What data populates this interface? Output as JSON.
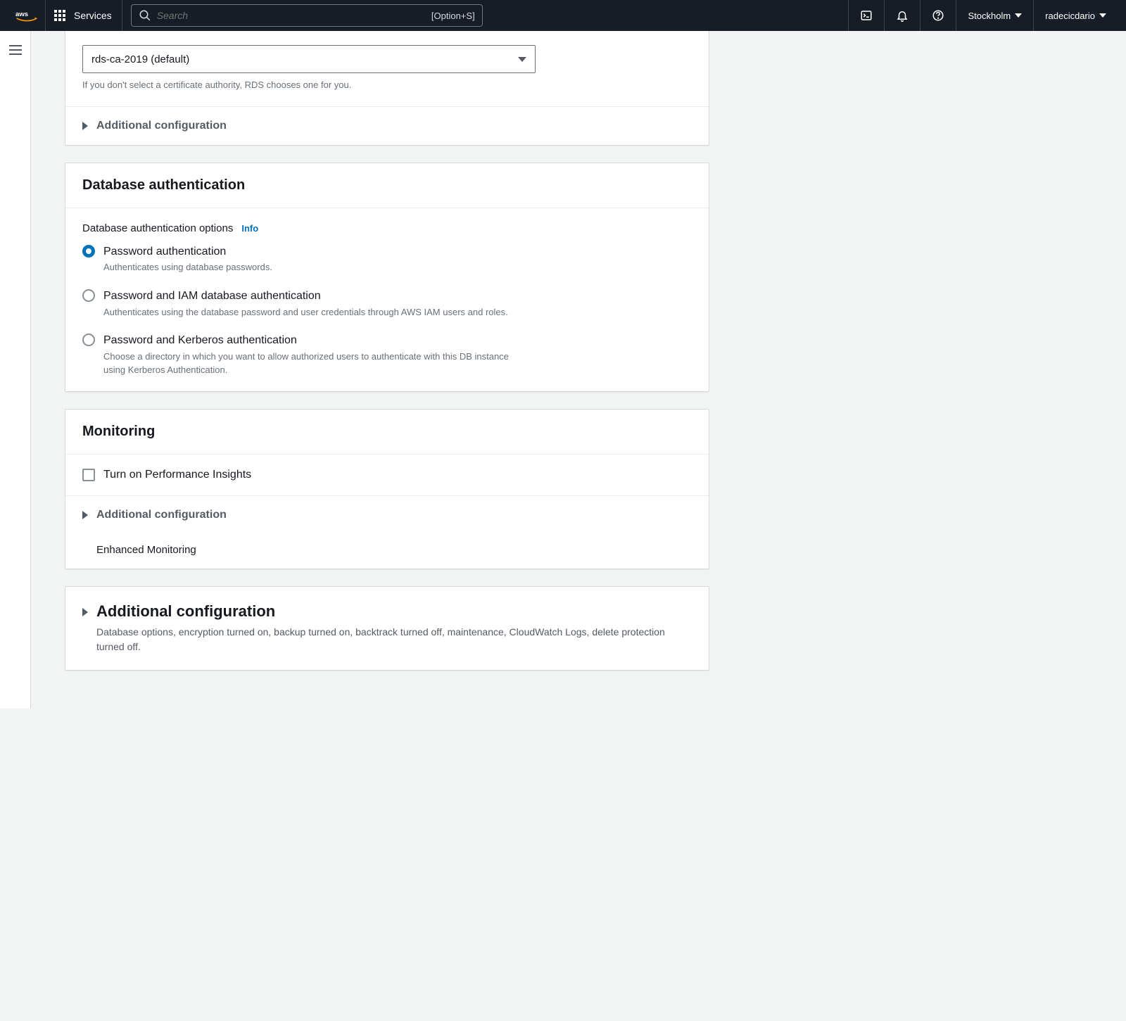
{
  "nav": {
    "services_label": "Services",
    "search_placeholder": "Search",
    "search_shortcut": "[Option+S]",
    "region": "Stockholm",
    "user": "radecicdario"
  },
  "certificate": {
    "selected": "rds-ca-2019 (default)",
    "help": "If you don't select a certificate authority, RDS chooses one for you."
  },
  "additional_config_label": "Additional configuration",
  "db_auth": {
    "header": "Database authentication",
    "field_label": "Database authentication options",
    "info_label": "Info",
    "options": [
      {
        "title": "Password authentication",
        "desc": "Authenticates using database passwords."
      },
      {
        "title": "Password and IAM database authentication",
        "desc": "Authenticates using the database password and user credentials through AWS IAM users and roles."
      },
      {
        "title": "Password and Kerberos authentication",
        "desc": "Choose a directory in which you want to allow authorized users to authenticate with this DB instance using Kerberos Authentication."
      }
    ]
  },
  "monitoring": {
    "header": "Monitoring",
    "checkbox_label": "Turn on Performance Insights",
    "additional_label": "Additional configuration",
    "enhanced_label": "Enhanced Monitoring"
  },
  "bottom_additional": {
    "label": "Additional configuration",
    "desc": "Database options, encryption turned on, backup turned on, backtrack turned off, maintenance, CloudWatch Logs, delete protection turned off."
  }
}
